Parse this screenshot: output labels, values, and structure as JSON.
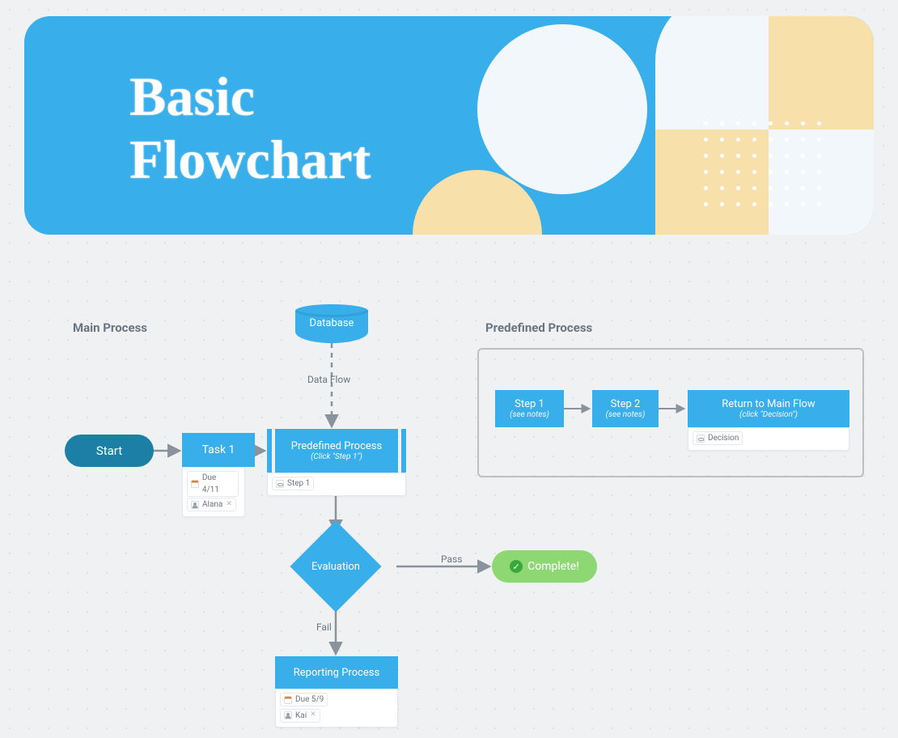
{
  "hero": {
    "title": "Basic\nFlowchart"
  },
  "sections": {
    "main_process": "Main Process",
    "predefined_process": "Predefined Process"
  },
  "nodes": {
    "database": "Database",
    "start": "Start",
    "task1": "Task 1",
    "predefined": {
      "title": "Predefined Process",
      "subtitle": "(Click \"Step 1\")"
    },
    "evaluation": "Evaluation",
    "complete": "Complete!",
    "reporting": "Reporting Process"
  },
  "edges": {
    "data_flow": "Data Flow",
    "pass": "Pass",
    "fail": "Fail"
  },
  "cards": {
    "task1": {
      "due": "Due 4/11",
      "assignee": "Alana"
    },
    "predefined": {
      "link": "Step 1"
    },
    "reporting": {
      "due": "Due 5/9",
      "assignee": "Kai"
    },
    "return": {
      "link": "Decision"
    }
  },
  "panel": {
    "step1": {
      "title": "Step 1",
      "subtitle": "(see notes)"
    },
    "step2": {
      "title": "Step 2",
      "subtitle": "(see notes)"
    },
    "return": {
      "title": "Return to  Main Flow",
      "subtitle": "(click \"Decision\")"
    }
  }
}
